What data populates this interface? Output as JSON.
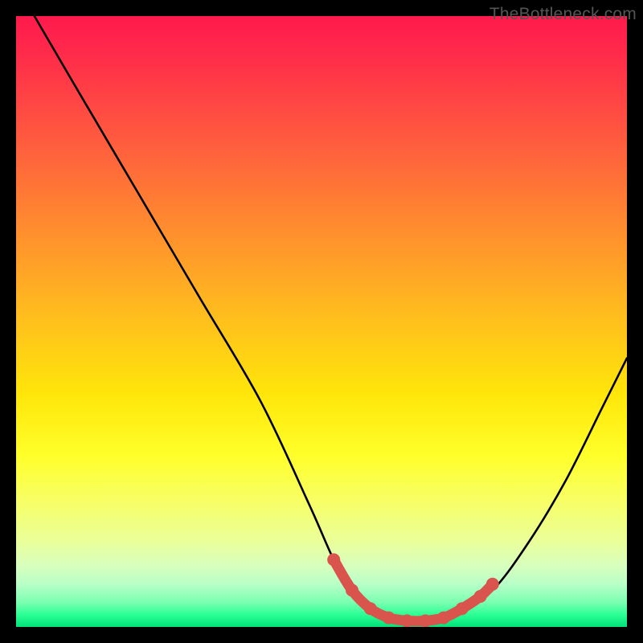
{
  "watermark": "TheBottleneck.com",
  "chart_data": {
    "type": "line",
    "title": "",
    "xlabel": "",
    "ylabel": "",
    "xlim": [
      0,
      100
    ],
    "ylim": [
      0,
      100
    ],
    "series": [
      {
        "name": "bottleneck-curve",
        "color": "#000000",
        "x": [
          3,
          10,
          20,
          30,
          40,
          48,
          52,
          55,
          58,
          62,
          66,
          72,
          78,
          84,
          90,
          96,
          100
        ],
        "y": [
          100,
          88,
          71,
          54,
          37,
          20,
          11,
          6,
          3,
          1,
          1,
          2,
          6,
          14,
          24,
          36,
          44
        ]
      }
    ],
    "markers": {
      "name": "highlighted-range",
      "color": "#d9544d",
      "points": [
        {
          "x": 52,
          "y": 11
        },
        {
          "x": 55,
          "y": 6
        },
        {
          "x": 58,
          "y": 3
        },
        {
          "x": 61,
          "y": 1.5
        },
        {
          "x": 64,
          "y": 1
        },
        {
          "x": 67,
          "y": 1
        },
        {
          "x": 70,
          "y": 1.5
        },
        {
          "x": 73,
          "y": 3
        },
        {
          "x": 76,
          "y": 5
        },
        {
          "x": 78,
          "y": 7
        }
      ]
    }
  }
}
